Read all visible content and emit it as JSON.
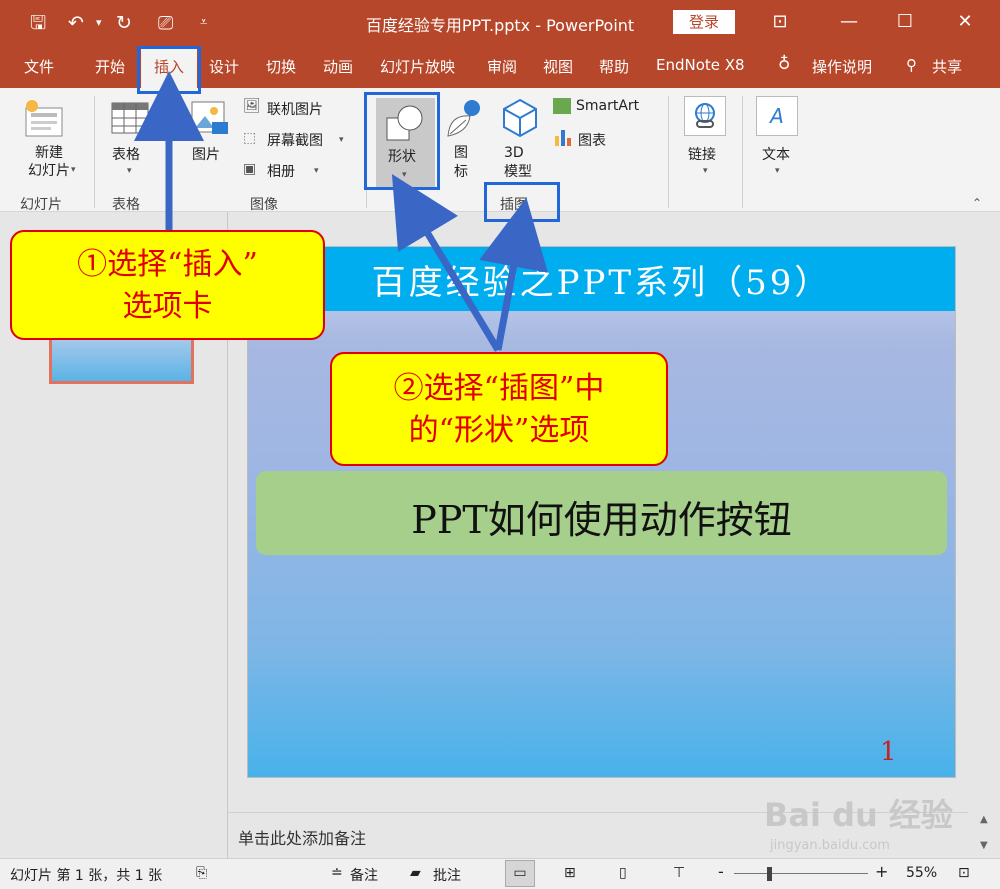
{
  "window": {
    "title": "百度经验专用PPT.pptx  -  PowerPoint",
    "login": "登录",
    "quick_access": [
      "save-icon",
      "undo-icon",
      "redo-icon",
      "present-icon",
      "customize-icon"
    ],
    "controls": [
      "ribbon-display-icon",
      "minimize-icon",
      "maximize-icon",
      "close-icon"
    ]
  },
  "tabs": {
    "file": "文件",
    "home": "开始",
    "insert": "插入",
    "design": "设计",
    "transitions": "切换",
    "animations": "动画",
    "slideshow": "幻灯片放映",
    "review": "审阅",
    "view": "视图",
    "help": "帮助",
    "endnote": "EndNote X8",
    "tell_me": "操作说明",
    "share": "共享"
  },
  "ribbon": {
    "new_slide": "新建\n幻灯片",
    "group_slides": "幻灯片",
    "table": "表格",
    "group_tables": "表格",
    "pictures": "图片",
    "online_pictures": "联机图片",
    "screenshot": "屏幕截图",
    "album": "相册",
    "group_images": "图像",
    "shapes": "形状",
    "icons": "图\n标",
    "models_3d": "3D\n模型",
    "smartart": "SmartArt",
    "chart": "图表",
    "group_illustrations": "插图",
    "links": "链接",
    "text": "文本",
    "text_icon_letter": "A"
  },
  "slide": {
    "title": "百度经验之PPT系列（59）",
    "subtitle": "PPT如何使用动作按钮",
    "number": "1"
  },
  "notes_placeholder": "单击此处添加备注",
  "status": {
    "slide_info": "幻灯片 第 1 张，共 1 张",
    "notes": "备注",
    "comments": "批注",
    "zoom_minus": "-",
    "zoom_plus": "+",
    "zoom": "55%"
  },
  "annotations": {
    "step1": "①选择“插入”\n选项卡",
    "step2": "②选择“插图”中\n的“形状”选项"
  },
  "watermark": {
    "logo": "Bai du 经验",
    "url": "jingyan.baidu.com"
  },
  "colors": {
    "titlebar": "#b7472a",
    "slide_header": "#00aeef",
    "subtitle_box": "#a6cf8b",
    "callout_fill": "#ffff00",
    "callout_text": "#e00000",
    "highlight": "#2266d8"
  }
}
